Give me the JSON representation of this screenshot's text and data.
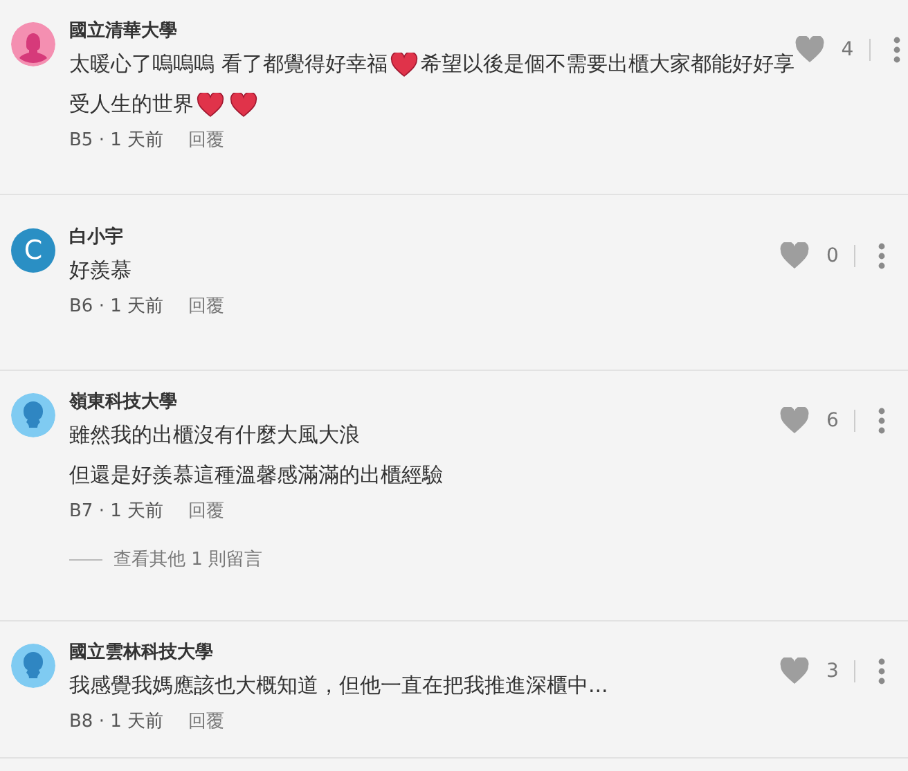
{
  "comments": [
    {
      "avatar": {
        "kind": "figure",
        "color": "#f48fb1"
      },
      "author": "國立清華大學",
      "likes": "4",
      "body": [
        [
          {
            "kind": "text",
            "text": "太暖心了嗚嗚嗚 看了都覺得好幸福"
          },
          {
            "kind": "heart"
          },
          {
            "kind": "text",
            "text": " 希望以後是個不需要出櫃大家都能好好享"
          }
        ],
        [
          {
            "kind": "text",
            "text": "受人生的世界"
          },
          {
            "kind": "heart"
          },
          {
            "kind": "heart"
          }
        ]
      ],
      "meta": "B5 · 1 天前",
      "reply": "回覆"
    },
    {
      "avatar": {
        "kind": "letter",
        "color": "#2a8fc4",
        "letter": "C"
      },
      "author": "白小宇",
      "likes": "0",
      "body": [
        [
          {
            "kind": "text",
            "text": "好羨慕"
          }
        ]
      ],
      "meta": "B6 · 1 天前",
      "reply": "回覆"
    },
    {
      "avatar": {
        "kind": "silhouette",
        "color": "#7fcbf2"
      },
      "author": "嶺東科技大學",
      "likes": "6",
      "body": [
        [
          {
            "kind": "text",
            "text": "雖然我的出櫃沒有什麼大風大浪"
          }
        ],
        [
          {
            "kind": "text",
            "text": "但還是好羨慕這種溫馨感滿滿的出櫃經驗"
          }
        ]
      ],
      "meta": "B7 · 1 天前",
      "reply": "回覆",
      "more_replies": "查看其他 1 則留言"
    },
    {
      "avatar": {
        "kind": "silhouette",
        "color": "#7fcbf2"
      },
      "author": "國立雲林科技大學",
      "likes": "3",
      "body": [
        [
          {
            "kind": "text",
            "text": "我感覺我媽應該也大概知道，但他一直在把我推進深櫃中..."
          }
        ]
      ],
      "meta": "B8 · 1 天前",
      "reply": "回覆"
    }
  ]
}
